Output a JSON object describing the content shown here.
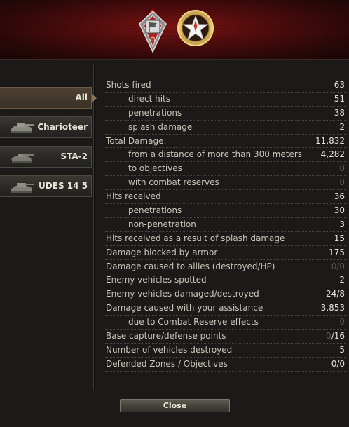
{
  "header": {
    "medals": [
      {
        "icon": "flag-shield-medal-icon"
      },
      {
        "icon": "star-wreath-medal-icon"
      }
    ]
  },
  "sidebar": {
    "items": [
      {
        "label": "All",
        "active": true
      },
      {
        "label": "Charioteer",
        "icon": "tank-icon"
      },
      {
        "label": "STA-2",
        "icon": "tank-icon"
      },
      {
        "label": "UDES 14 5",
        "icon": "tank-icon"
      }
    ]
  },
  "stats": [
    {
      "label": "Shots fired",
      "value": "63"
    },
    {
      "label": "direct hits",
      "value": "51",
      "sub": true
    },
    {
      "label": "penetrations",
      "value": "38",
      "sub": true
    },
    {
      "label": "splash damage",
      "value": "2",
      "sub": true
    },
    {
      "label": "Total Damage:",
      "value": "11,832"
    },
    {
      "label": "from a distance of more than 300 meters",
      "value": "4,282",
      "sub": true
    },
    {
      "label": "to objectives",
      "value": "0",
      "sub": true,
      "dim": true
    },
    {
      "label": "with combat reserves",
      "value": "0",
      "sub": true,
      "dim": true
    },
    {
      "label": "Hits received",
      "value": "36"
    },
    {
      "label": "penetrations",
      "value": "30",
      "sub": true
    },
    {
      "label": "non-penetration",
      "value": "3",
      "sub": true
    },
    {
      "label": "Hits received as a result of splash damage",
      "value": "15"
    },
    {
      "label": "Damage blocked by armor",
      "value": "175"
    },
    {
      "label": "Damage caused to allies (destroyed/HP)",
      "value": "0/0",
      "dim": true
    },
    {
      "label": "Enemy vehicles spotted",
      "value": "2"
    },
    {
      "label": "Enemy vehicles damaged/destroyed",
      "value": "24/8"
    },
    {
      "label": "Damage caused with your assistance",
      "value": "3,853"
    },
    {
      "label": "due to Combat Reserve effects",
      "value": "0",
      "sub": true,
      "dim": true
    },
    {
      "label": "Base capture/defense points",
      "value_dim": "0",
      "value": "/16"
    },
    {
      "label": "Number of vehicles destroyed",
      "value": "5"
    },
    {
      "label": "Defended Zones / Objectives",
      "value": "0/0"
    }
  ],
  "footer": {
    "close_label": "Close"
  },
  "colors": {
    "header_red": "#7a1212",
    "text": "#c9c5b8",
    "dim_value": "#5a5852"
  }
}
